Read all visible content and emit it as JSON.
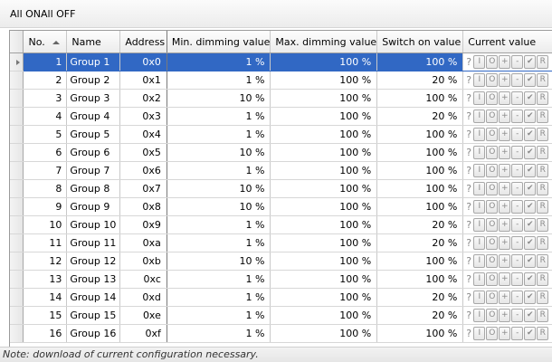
{
  "toolbar": {
    "all_on": "All ON",
    "all_off": "All OFF"
  },
  "columns": {
    "no": "No.",
    "name": "Name",
    "address": "Address",
    "min": "Min. dimming value",
    "max": "Max. dimming value",
    "switch_on": "Switch on value",
    "current": "Current value"
  },
  "sort": {
    "column": "No.",
    "direction": "ascending"
  },
  "selected_row": 1,
  "current_value_controls": [
    "?",
    "I",
    "O",
    "+",
    "-",
    "✔",
    "R"
  ],
  "rows": [
    {
      "no": "1",
      "name": "Group 1",
      "address": "0x0",
      "min": "1 %",
      "max": "100 %",
      "switch_on": "100 %"
    },
    {
      "no": "2",
      "name": "Group 2",
      "address": "0x1",
      "min": "1 %",
      "max": "100 %",
      "switch_on": "20 %"
    },
    {
      "no": "3",
      "name": "Group 3",
      "address": "0x2",
      "min": "10 %",
      "max": "100 %",
      "switch_on": "100 %"
    },
    {
      "no": "4",
      "name": "Group 4",
      "address": "0x3",
      "min": "1 %",
      "max": "100 %",
      "switch_on": "20 %"
    },
    {
      "no": "5",
      "name": "Group 5",
      "address": "0x4",
      "min": "1 %",
      "max": "100 %",
      "switch_on": "100 %"
    },
    {
      "no": "6",
      "name": "Group 6",
      "address": "0x5",
      "min": "10 %",
      "max": "100 %",
      "switch_on": "100 %"
    },
    {
      "no": "7",
      "name": "Group 7",
      "address": "0x6",
      "min": "1 %",
      "max": "100 %",
      "switch_on": "100 %"
    },
    {
      "no": "8",
      "name": "Group 8",
      "address": "0x7",
      "min": "10 %",
      "max": "100 %",
      "switch_on": "100 %"
    },
    {
      "no": "9",
      "name": "Group 9",
      "address": "0x8",
      "min": "10 %",
      "max": "100 %",
      "switch_on": "100 %"
    },
    {
      "no": "10",
      "name": "Group 10",
      "address": "0x9",
      "min": "1 %",
      "max": "100 %",
      "switch_on": "20 %"
    },
    {
      "no": "11",
      "name": "Group 11",
      "address": "0xa",
      "min": "1 %",
      "max": "100 %",
      "switch_on": "20 %"
    },
    {
      "no": "12",
      "name": "Group 12",
      "address": "0xb",
      "min": "10 %",
      "max": "100 %",
      "switch_on": "100 %"
    },
    {
      "no": "13",
      "name": "Group 13",
      "address": "0xc",
      "min": "1 %",
      "max": "100 %",
      "switch_on": "100 %"
    },
    {
      "no": "14",
      "name": "Group 14",
      "address": "0xd",
      "min": "1 %",
      "max": "100 %",
      "switch_on": "20 %"
    },
    {
      "no": "15",
      "name": "Group 15",
      "address": "0xe",
      "min": "1 %",
      "max": "100 %",
      "switch_on": "20 %"
    },
    {
      "no": "16",
      "name": "Group 16",
      "address": "0xf",
      "min": "1 %",
      "max": "100 %",
      "switch_on": "100 %"
    }
  ],
  "status": {
    "note": "Note: download of current configuration necessary."
  },
  "colors": {
    "selection": "#3168c4",
    "header_bg": "#ececec",
    "grid_line": "#c9c9c9"
  }
}
